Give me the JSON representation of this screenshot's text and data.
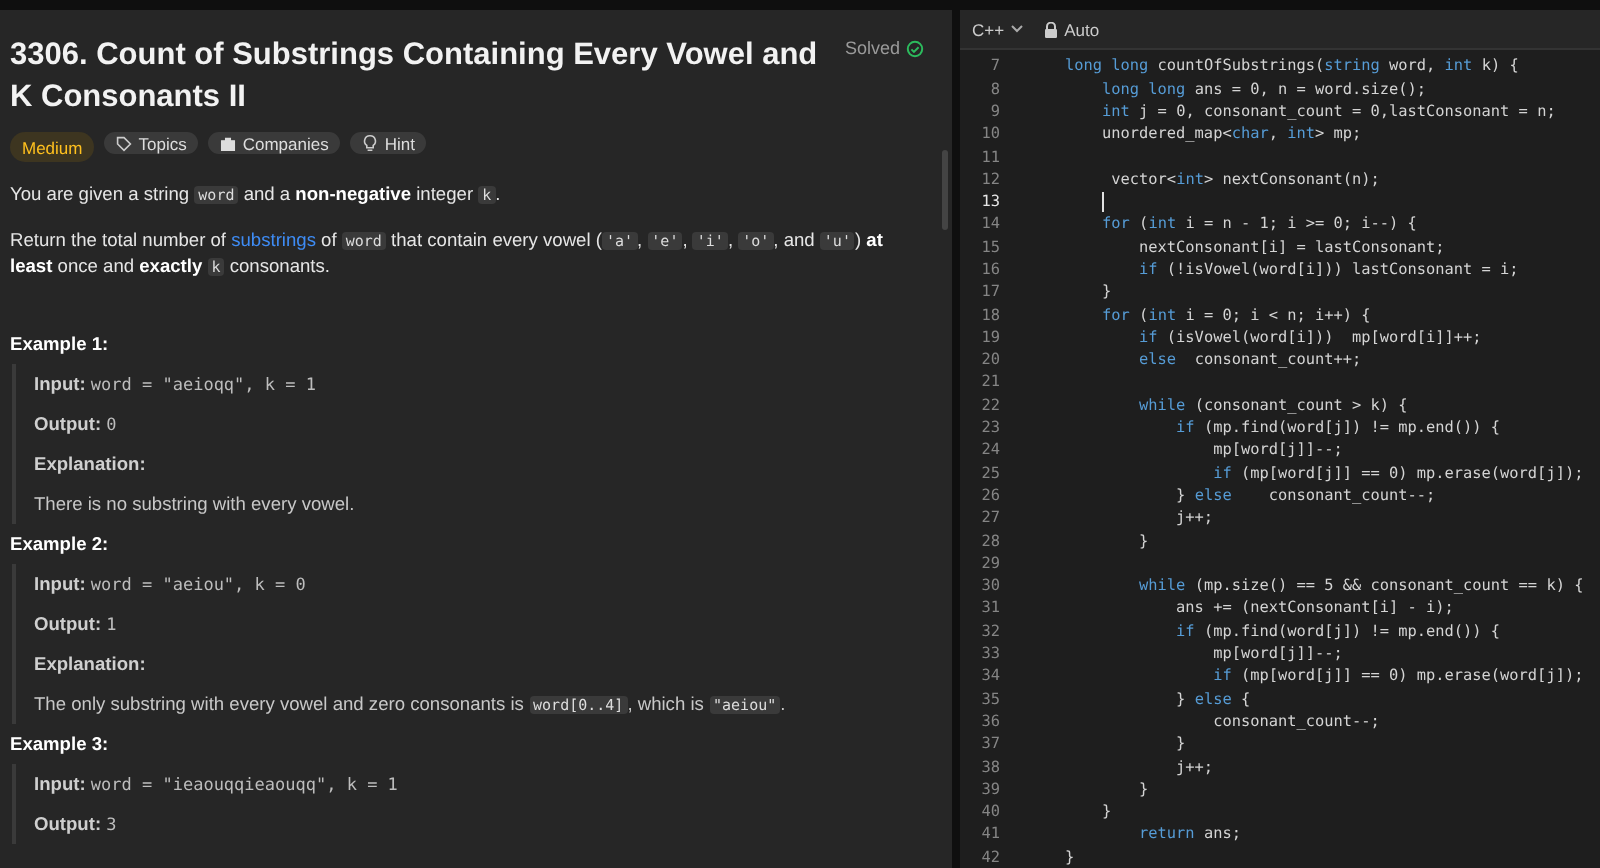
{
  "problem": {
    "title": "3306. Count of Substrings Containing Every Vowel and K Consonants II",
    "status": {
      "label": "Solved",
      "solved": true
    },
    "tags": [
      {
        "label": "Medium",
        "kind": "difficulty"
      },
      {
        "label": "Topics",
        "kind": "topics"
      },
      {
        "label": "Companies",
        "kind": "companies"
      },
      {
        "label": "Hint",
        "kind": "hint"
      }
    ],
    "description": [
      [
        {
          "text": "You are given a string ",
          "kind": "text"
        },
        {
          "text": "word",
          "kind": "code"
        },
        {
          "text": " and a ",
          "kind": "text"
        },
        {
          "text": "non-negative",
          "kind": "bold"
        },
        {
          "text": " integer ",
          "kind": "text"
        },
        {
          "text": "k",
          "kind": "code"
        },
        {
          "text": ".",
          "kind": "text"
        }
      ],
      [
        {
          "text": "Return the total number of ",
          "kind": "text"
        },
        {
          "text": "substrings",
          "kind": "link"
        },
        {
          "text": " of ",
          "kind": "text"
        },
        {
          "text": "word",
          "kind": "code"
        },
        {
          "text": " that contain every vowel (",
          "kind": "text"
        },
        {
          "text": "'a'",
          "kind": "code"
        },
        {
          "text": ", ",
          "kind": "text"
        },
        {
          "text": "'e'",
          "kind": "code"
        },
        {
          "text": ", ",
          "kind": "text"
        },
        {
          "text": "'i'",
          "kind": "code"
        },
        {
          "text": ", ",
          "kind": "text"
        },
        {
          "text": "'o'",
          "kind": "code"
        },
        {
          "text": ", and ",
          "kind": "text"
        },
        {
          "text": "'u'",
          "kind": "code"
        },
        {
          "text": ") ",
          "kind": "text"
        },
        {
          "text": "at least",
          "kind": "bold"
        },
        {
          "text": " once and ",
          "kind": "text"
        },
        {
          "text": "exactly ",
          "kind": "bold"
        },
        {
          "text": "k",
          "kind": "code"
        },
        {
          "text": " consonants.",
          "kind": "text"
        }
      ]
    ],
    "examples": [
      {
        "heading": "Example 1:",
        "input_label": "Input:",
        "input": "word = \"aeioqq\", k = 1",
        "output_label": "Output:",
        "output": "0",
        "explanation_label": "Explanation:",
        "explanation": [
          {
            "text": "There is no substring with every vowel.",
            "kind": "text"
          }
        ]
      },
      {
        "heading": "Example 2:",
        "input_label": "Input:",
        "input": "word = \"aeiou\", k = 0",
        "output_label": "Output:",
        "output": "1",
        "explanation_label": "Explanation:",
        "explanation": [
          {
            "text": "The only substring with every vowel and zero consonants is ",
            "kind": "text"
          },
          {
            "text": "word[0..4]",
            "kind": "code"
          },
          {
            "text": ", which is ",
            "kind": "text"
          },
          {
            "text": "\"aeiou\"",
            "kind": "code"
          },
          {
            "text": ".",
            "kind": "text"
          }
        ]
      },
      {
        "heading": "Example 3:",
        "input_label": "Input:",
        "input": "word = \"ieaouqqieaouqq\", k = 1",
        "output_label": "Output:",
        "output": "3"
      }
    ]
  },
  "editor": {
    "language": "C++",
    "mode": "Auto",
    "lines": [
      {
        "number": "7",
        "current": false,
        "segments": [
          {
            "text": "    long long",
            "kind": "keyword"
          },
          {
            "text": " countOfSubstrings(",
            "kind": "plain"
          },
          {
            "text": "string",
            "kind": "keyword"
          },
          {
            "text": " word, ",
            "kind": "plain"
          },
          {
            "text": "int",
            "kind": "keyword"
          },
          {
            "text": " k) {",
            "kind": "plain"
          }
        ]
      },
      {
        "number": "8",
        "current": false,
        "segments": [
          {
            "text": "        long long",
            "kind": "keyword"
          },
          {
            "text": " ans = 0, n = word.size();",
            "kind": "plain"
          }
        ]
      },
      {
        "number": "9",
        "current": false,
        "segments": [
          {
            "text": "        int",
            "kind": "keyword"
          },
          {
            "text": " j = 0, consonant_count = 0,lastConsonant = n;",
            "kind": "plain"
          }
        ]
      },
      {
        "number": "10",
        "current": false,
        "segments": [
          {
            "text": "        unordered_map<",
            "kind": "plain"
          },
          {
            "text": "char",
            "kind": "keyword"
          },
          {
            "text": ", ",
            "kind": "plain"
          },
          {
            "text": "int",
            "kind": "keyword"
          },
          {
            "text": "> mp;",
            "kind": "plain"
          }
        ]
      },
      {
        "number": "11",
        "current": false
      },
      {
        "number": "12",
        "current": false,
        "segments": [
          {
            "text": "         vector<",
            "kind": "plain"
          },
          {
            "text": "int",
            "kind": "keyword"
          },
          {
            "text": "> nextConsonant(n);",
            "kind": "plain"
          }
        ]
      },
      {
        "number": "13",
        "current": true
      },
      {
        "number": "14",
        "current": false,
        "segments": [
          {
            "text": "        for",
            "kind": "keyword"
          },
          {
            "text": " (",
            "kind": "plain"
          },
          {
            "text": "int",
            "kind": "keyword"
          },
          {
            "text": " i = n - 1; i >= 0; i--) {",
            "kind": "plain"
          }
        ]
      },
      {
        "number": "15",
        "current": false,
        "segments": [
          {
            "text": "            nextConsonant[i] = lastConsonant;",
            "kind": "plain"
          }
        ]
      },
      {
        "number": "16",
        "current": false,
        "segments": [
          {
            "text": "            if",
            "kind": "keyword"
          },
          {
            "text": " (!isVowel(word[i])) lastConsonant = i;",
            "kind": "plain"
          }
        ]
      },
      {
        "number": "17",
        "current": false,
        "segments": [
          {
            "text": "        }",
            "kind": "plain"
          }
        ]
      },
      {
        "number": "18",
        "current": false,
        "segments": [
          {
            "text": "        for",
            "kind": "keyword"
          },
          {
            "text": " (",
            "kind": "plain"
          },
          {
            "text": "int",
            "kind": "keyword"
          },
          {
            "text": " i = 0; i < n; i++) {",
            "kind": "plain"
          }
        ]
      },
      {
        "number": "19",
        "current": false,
        "segments": [
          {
            "text": "            if",
            "kind": "keyword"
          },
          {
            "text": " (isVowel(word[i]))  mp[word[i]]++;",
            "kind": "plain"
          }
        ]
      },
      {
        "number": "20",
        "current": false,
        "segments": [
          {
            "text": "            else",
            "kind": "keyword"
          },
          {
            "text": "  consonant_count++;",
            "kind": "plain"
          }
        ]
      },
      {
        "number": "21",
        "current": false
      },
      {
        "number": "22",
        "current": false,
        "segments": [
          {
            "text": "            while",
            "kind": "keyword"
          },
          {
            "text": " (consonant_count > k) {",
            "kind": "plain"
          }
        ]
      },
      {
        "number": "23",
        "current": false,
        "segments": [
          {
            "text": "                if",
            "kind": "keyword"
          },
          {
            "text": " (mp.find(word[j]) != mp.end()) {",
            "kind": "plain"
          }
        ]
      },
      {
        "number": "24",
        "current": false,
        "segments": [
          {
            "text": "                    mp[word[j]]--;",
            "kind": "plain"
          }
        ]
      },
      {
        "number": "25",
        "current": false,
        "segments": [
          {
            "text": "                    if",
            "kind": "keyword"
          },
          {
            "text": " (mp[word[j]] == 0) mp.erase(word[j]);",
            "kind": "plain"
          }
        ]
      },
      {
        "number": "26",
        "current": false,
        "segments": [
          {
            "text": "                } ",
            "kind": "plain"
          },
          {
            "text": "else",
            "kind": "keyword"
          },
          {
            "text": "    consonant_count--;",
            "kind": "plain"
          }
        ]
      },
      {
        "number": "27",
        "current": false,
        "segments": [
          {
            "text": "                j++;",
            "kind": "plain"
          }
        ]
      },
      {
        "number": "28",
        "current": false,
        "segments": [
          {
            "text": "            }",
            "kind": "plain"
          }
        ]
      },
      {
        "number": "29",
        "current": false
      },
      {
        "number": "30",
        "current": false,
        "segments": [
          {
            "text": "            while",
            "kind": "keyword"
          },
          {
            "text": " (mp.size() == 5 && consonant_count == k) {",
            "kind": "plain"
          }
        ]
      },
      {
        "number": "31",
        "current": false,
        "segments": [
          {
            "text": "                ans += (nextConsonant[i] - i);",
            "kind": "plain"
          }
        ]
      },
      {
        "number": "32",
        "current": false,
        "segments": [
          {
            "text": "                if",
            "kind": "keyword"
          },
          {
            "text": " (mp.find(word[j]) != mp.end()) {",
            "kind": "plain"
          }
        ]
      },
      {
        "number": "33",
        "current": false,
        "segments": [
          {
            "text": "                    mp[word[j]]--;",
            "kind": "plain"
          }
        ]
      },
      {
        "number": "34",
        "current": false,
        "segments": [
          {
            "text": "                    if",
            "kind": "keyword"
          },
          {
            "text": " (mp[word[j]] == 0) mp.erase(word[j]);",
            "kind": "plain"
          }
        ]
      },
      {
        "number": "35",
        "current": false,
        "segments": [
          {
            "text": "                } ",
            "kind": "plain"
          },
          {
            "text": "else",
            "kind": "keyword"
          },
          {
            "text": " {",
            "kind": "plain"
          }
        ]
      },
      {
        "number": "36",
        "current": false,
        "segments": [
          {
            "text": "                    consonant_count--;",
            "kind": "plain"
          }
        ]
      },
      {
        "number": "37",
        "current": false,
        "segments": [
          {
            "text": "                }",
            "kind": "plain"
          }
        ]
      },
      {
        "number": "38",
        "current": false,
        "segments": [
          {
            "text": "                j++;",
            "kind": "plain"
          }
        ]
      },
      {
        "number": "39",
        "current": false,
        "segments": [
          {
            "text": "            }",
            "kind": "plain"
          }
        ]
      },
      {
        "number": "40",
        "current": false,
        "segments": [
          {
            "text": "        }",
            "kind": "plain"
          }
        ]
      },
      {
        "number": "41",
        "current": false,
        "segments": [
          {
            "text": "            return",
            "kind": "keyword"
          },
          {
            "text": " ans;",
            "kind": "plain"
          }
        ]
      },
      {
        "number": "42",
        "current": false,
        "segments": [
          {
            "text": "    }",
            "kind": "plain"
          }
        ]
      }
    ]
  }
}
